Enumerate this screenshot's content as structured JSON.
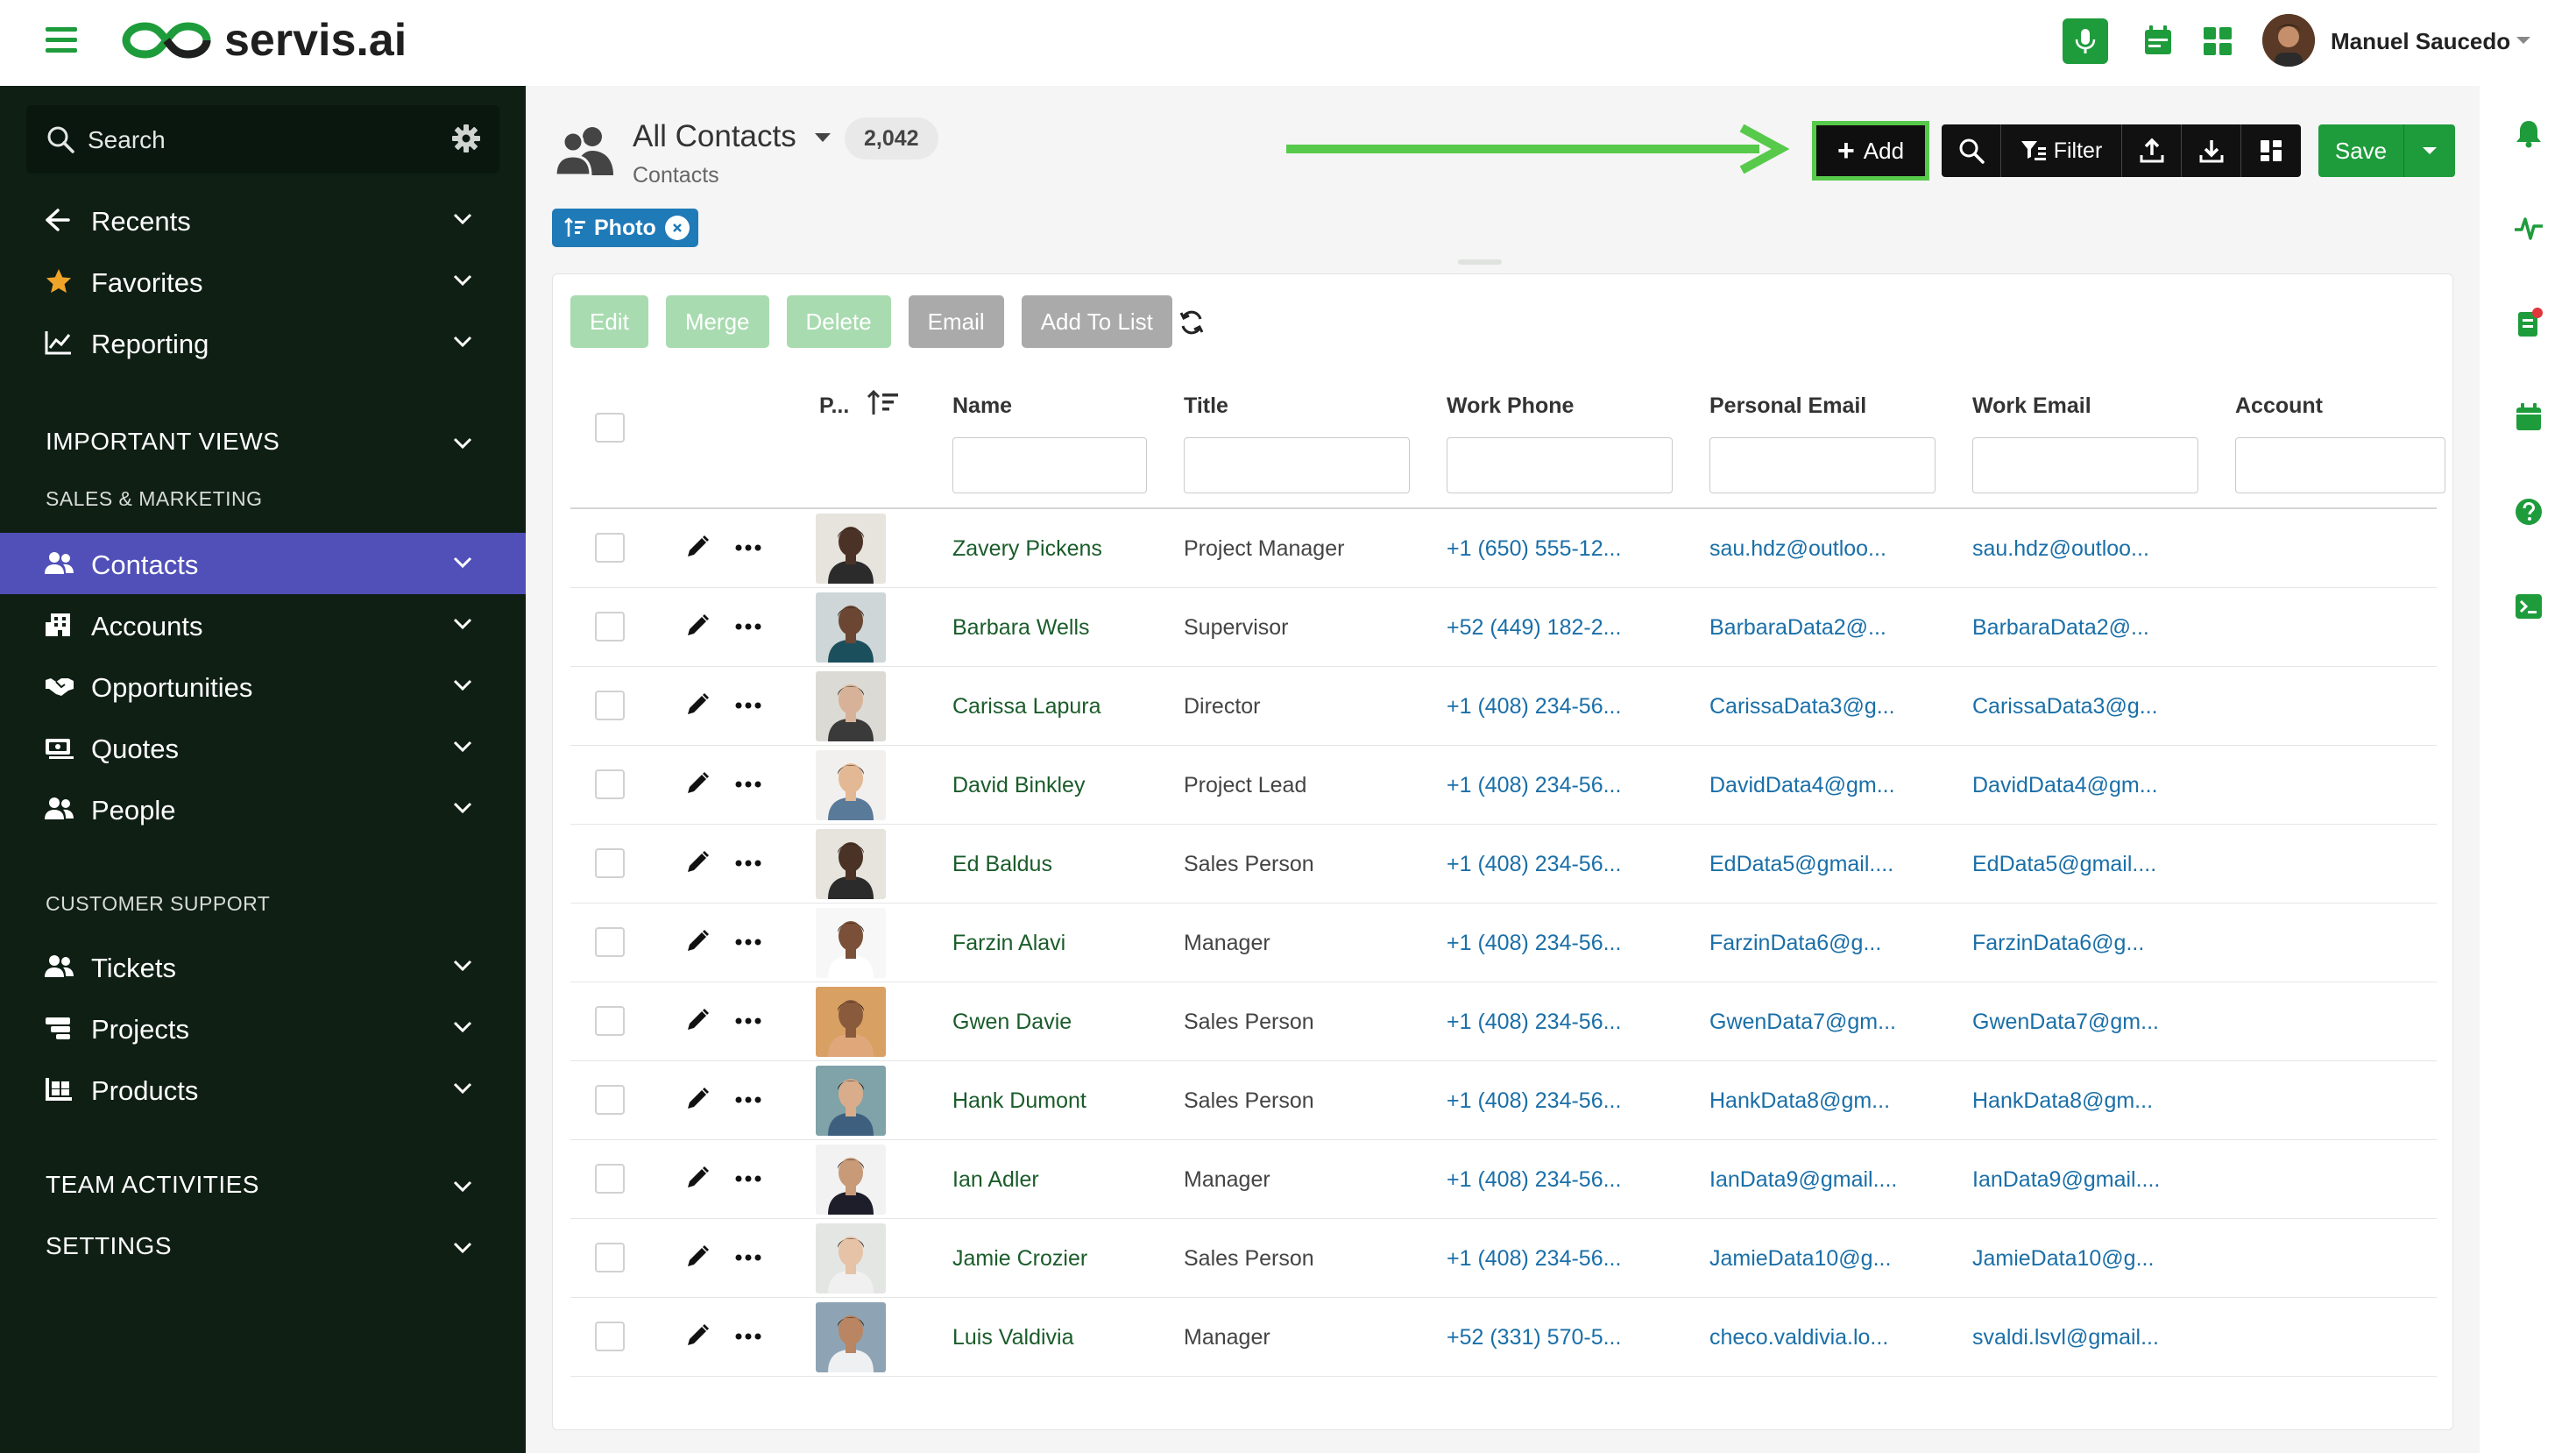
{
  "brand": {
    "name": "servis.ai"
  },
  "user": {
    "name": "Manuel Saucedo"
  },
  "topbar_icons": [
    "microphone-icon",
    "calendar-icon",
    "apps-grid-icon"
  ],
  "sidebar": {
    "search_label": "Search",
    "top_items": [
      {
        "label": "Recents",
        "icon": "arrow-left-icon"
      },
      {
        "label": "Favorites",
        "icon": "star-icon"
      },
      {
        "label": "Reporting",
        "icon": "line-chart-icon"
      }
    ],
    "important_views": "IMPORTANT VIEWS",
    "sales_marketing": "SALES & MARKETING",
    "sales_items": [
      {
        "label": "Contacts",
        "icon": "users-icon",
        "active": true
      },
      {
        "label": "Accounts",
        "icon": "building-icon"
      },
      {
        "label": "Opportunities",
        "icon": "handshake-icon"
      },
      {
        "label": "Quotes",
        "icon": "money-icon"
      },
      {
        "label": "People",
        "icon": "users-icon"
      }
    ],
    "customer_support": "CUSTOMER SUPPORT",
    "support_items": [
      {
        "label": "Tickets",
        "icon": "users-icon"
      },
      {
        "label": "Projects",
        "icon": "projects-icon"
      },
      {
        "label": "Products",
        "icon": "products-icon"
      }
    ],
    "team_activities": "TEAM ACTIVITIES",
    "settings": "SETTINGS"
  },
  "view": {
    "title": "All Contacts",
    "count": "2,042",
    "subtitle": "Contacts",
    "filter_chip": "Photo"
  },
  "toolbar": {
    "add_label": "Add",
    "filter_label": "Filter",
    "save_label": "Save"
  },
  "actions": {
    "edit": "Edit",
    "merge": "Merge",
    "delete": "Delete",
    "email": "Email",
    "add_to_list": "Add To List"
  },
  "columns": {
    "photo": "P...",
    "name": "Name",
    "title": "Title",
    "work_phone": "Work Phone",
    "personal_email": "Personal Email",
    "work_email": "Work Email",
    "account": "Account"
  },
  "rows": [
    {
      "name": "Zavery Pickens",
      "title": "Project Manager",
      "phone": "+1 (650) 555-12...",
      "pemail": "sau.hdz@outloo...",
      "wemail": "sau.hdz@outloo...",
      "skin": "#4a3326",
      "bg": "#e7e3dd",
      "shirt": "#2b2b2b"
    },
    {
      "name": "Barbara Wells",
      "title": "Supervisor",
      "phone": "+52 (449) 182-2...",
      "pemail": "BarbaraData2@...",
      "wemail": "BarbaraData2@...",
      "skin": "#6b4633",
      "bg": "#cfd6d8",
      "shirt": "#1b4f5c"
    },
    {
      "name": "Carissa Lapura",
      "title": "Director",
      "phone": "+1 (408) 234-56...",
      "pemail": "CarissaData3@g...",
      "wemail": "CarissaData3@g...",
      "skin": "#d8b298",
      "bg": "#dcdad4",
      "shirt": "#3a3a3a"
    },
    {
      "name": "David Binkley",
      "title": "Project Lead",
      "phone": "+1 (408) 234-56...",
      "pemail": "DavidData4@gm...",
      "wemail": "DavidData4@gm...",
      "skin": "#e3b894",
      "bg": "#f2f0ee",
      "shirt": "#5a7a9a"
    },
    {
      "name": "Ed Baldus",
      "title": "Sales Person",
      "phone": "+1 (408) 234-56...",
      "pemail": "EdData5@gmail....",
      "wemail": "EdData5@gmail....",
      "skin": "#4a3326",
      "bg": "#e7e3dd",
      "shirt": "#2b2b2b"
    },
    {
      "name": "Farzin Alavi",
      "title": "Manager",
      "phone": "+1 (408) 234-56...",
      "pemail": "FarzinData6@g...",
      "wemail": "FarzinData6@g...",
      "skin": "#7a5038",
      "bg": "#f7f7f7",
      "shirt": "#ffffff"
    },
    {
      "name": "Gwen Davie",
      "title": "Sales Person",
      "phone": "+1 (408) 234-56...",
      "pemail": "GwenData7@gm...",
      "wemail": "GwenData7@gm...",
      "skin": "#8a5a3c",
      "bg": "#d9a064",
      "shirt": "#e0a87a"
    },
    {
      "name": "Hank Dumont",
      "title": "Sales Person",
      "phone": "+1 (408) 234-56...",
      "pemail": "HankData8@gm...",
      "wemail": "HankData8@gm...",
      "skin": "#d9ad8c",
      "bg": "#7fa3a8",
      "shirt": "#3f5f7f"
    },
    {
      "name": "Ian Adler",
      "title": "Manager",
      "phone": "+1 (408) 234-56...",
      "pemail": "IanData9@gmail....",
      "wemail": "IanData9@gmail....",
      "skin": "#c99a78",
      "bg": "#f2f2f2",
      "shirt": "#1e1e2a"
    },
    {
      "name": "Jamie Crozier",
      "title": "Sales Person",
      "phone": "+1 (408) 234-56...",
      "pemail": "JamieData10@g...",
      "wemail": "JamieData10@g...",
      "skin": "#e6c2a6",
      "bg": "#e4e6e4",
      "shirt": "#f0f0f0"
    },
    {
      "name": "Luis Valdivia",
      "title": "Manager",
      "phone": "+52 (331) 570-5...",
      "pemail": "checo.valdivia.lo...",
      "wemail": "svaldi.lsvl@gmail...",
      "skin": "#b98562",
      "bg": "#8ea4b4",
      "shirt": "#eef0f2"
    }
  ],
  "colors": {
    "accent_green": "#1e9c3c",
    "sidebar_bg": "#0f1f14",
    "active_nav": "#5150b8",
    "chip_blue": "#1f7ab8",
    "highlight_arrow": "#57c94b"
  }
}
